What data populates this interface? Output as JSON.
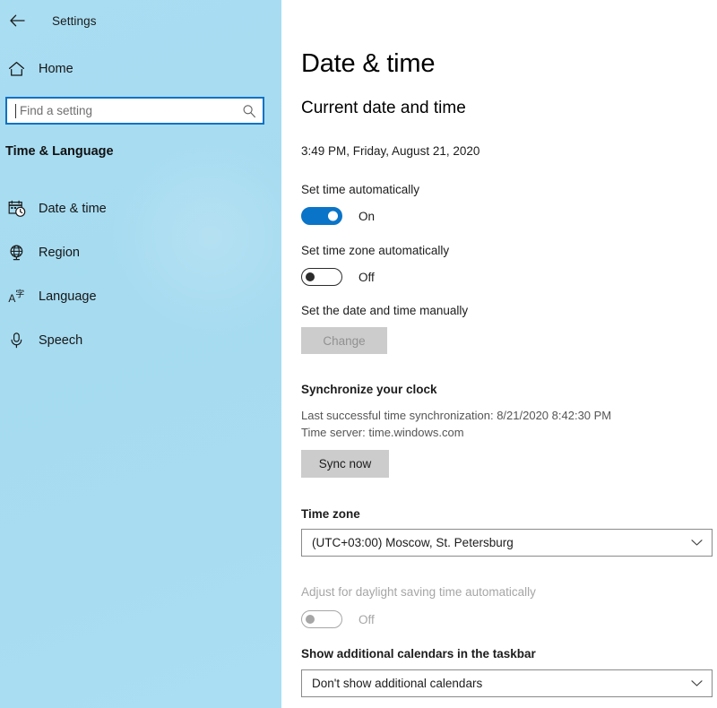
{
  "window": {
    "back_label": "←",
    "title": "Settings"
  },
  "sidebar": {
    "home_label": "Home",
    "search": {
      "placeholder": "Find a setting",
      "value": ""
    },
    "section_heading": "Time & Language",
    "items": [
      {
        "label": "Date & time",
        "icon": "calendar-clock-icon"
      },
      {
        "label": "Region",
        "icon": "globe-icon"
      },
      {
        "label": "Language",
        "icon": "language-icon"
      },
      {
        "label": "Speech",
        "icon": "microphone-icon"
      }
    ]
  },
  "main": {
    "page_title": "Date & time",
    "current_section_heading": "Current date and time",
    "current_datetime": "3:49 PM, Friday, August 21, 2020",
    "set_time_automatically": {
      "label": "Set time automatically",
      "state": "On",
      "enabled": true
    },
    "set_timezone_automatically": {
      "label": "Set time zone automatically",
      "state": "Off",
      "enabled": true
    },
    "set_manually": {
      "label": "Set the date and time manually",
      "button_label": "Change",
      "button_enabled": false
    },
    "synchronize": {
      "heading": "Synchronize your clock",
      "last_sync": "Last successful time synchronization: 8/21/2020 8:42:30 PM",
      "time_server": "Time server: time.windows.com",
      "button_label": "Sync now",
      "button_enabled": true
    },
    "time_zone": {
      "label": "Time zone",
      "value": "(UTC+03:00) Moscow, St. Petersburg"
    },
    "daylight_saving": {
      "label": "Adjust for daylight saving time automatically",
      "state": "Off",
      "enabled": false
    },
    "additional_calendars": {
      "label": "Show additional calendars in the taskbar",
      "value": "Don't show additional calendars"
    }
  },
  "colors": {
    "accent": "#0a74c8",
    "sidebar": "#a9ddf2",
    "button": "#cccccc",
    "disabled": "#a6a6a6"
  }
}
